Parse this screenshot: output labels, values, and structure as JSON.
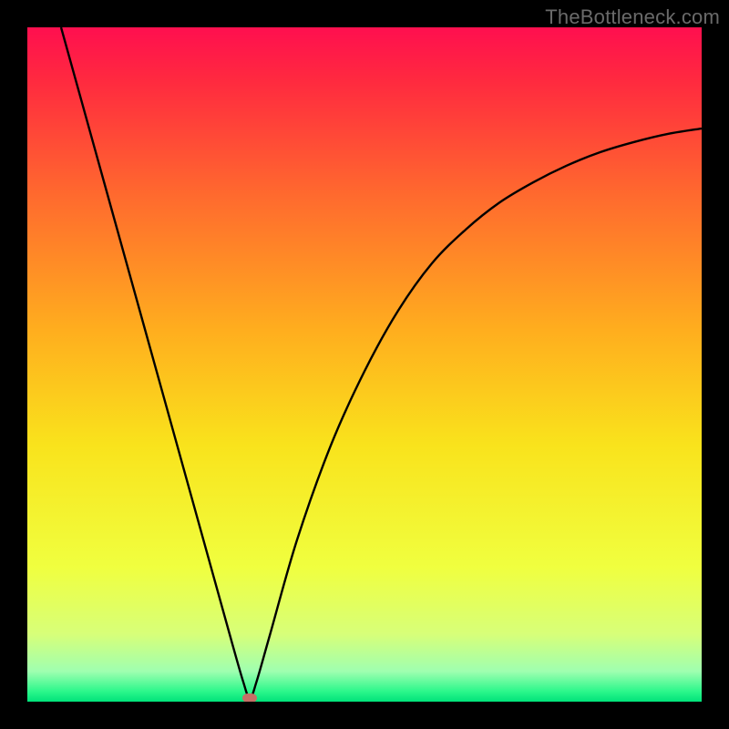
{
  "watermark": "TheBottleneck.com",
  "chart_data": {
    "type": "line",
    "title": "",
    "xlabel": "",
    "ylabel": "",
    "xlim": [
      0,
      100
    ],
    "ylim": [
      0,
      100
    ],
    "grid": false,
    "series": [
      {
        "name": "curve",
        "points": [
          {
            "x": 5,
            "y": 100
          },
          {
            "x": 10,
            "y": 82
          },
          {
            "x": 15,
            "y": 64
          },
          {
            "x": 20,
            "y": 46
          },
          {
            "x": 25,
            "y": 28
          },
          {
            "x": 30,
            "y": 10
          },
          {
            "x": 32,
            "y": 3
          },
          {
            "x": 33,
            "y": 0.5
          },
          {
            "x": 34,
            "y": 3
          },
          {
            "x": 36,
            "y": 10
          },
          {
            "x": 40,
            "y": 24
          },
          {
            "x": 45,
            "y": 38
          },
          {
            "x": 50,
            "y": 49
          },
          {
            "x": 55,
            "y": 58
          },
          {
            "x": 60,
            "y": 65
          },
          {
            "x": 65,
            "y": 70
          },
          {
            "x": 70,
            "y": 74
          },
          {
            "x": 75,
            "y": 77
          },
          {
            "x": 80,
            "y": 79.5
          },
          {
            "x": 85,
            "y": 81.5
          },
          {
            "x": 90,
            "y": 83
          },
          {
            "x": 95,
            "y": 84.2
          },
          {
            "x": 100,
            "y": 85
          }
        ]
      }
    ],
    "marker": {
      "x": 33,
      "y": 0.5,
      "color": "#c56f66"
    },
    "background_gradient": {
      "stops": [
        {
          "offset": 0.0,
          "color": "#ff0f4f"
        },
        {
          "offset": 0.08,
          "color": "#ff2a3f"
        },
        {
          "offset": 0.25,
          "color": "#ff6a2e"
        },
        {
          "offset": 0.45,
          "color": "#ffae1e"
        },
        {
          "offset": 0.62,
          "color": "#f9e31c"
        },
        {
          "offset": 0.8,
          "color": "#f0ff3f"
        },
        {
          "offset": 0.9,
          "color": "#d7ff79"
        },
        {
          "offset": 0.955,
          "color": "#9fffb0"
        },
        {
          "offset": 0.985,
          "color": "#2bf78b"
        },
        {
          "offset": 1.0,
          "color": "#00e27a"
        }
      ]
    }
  }
}
